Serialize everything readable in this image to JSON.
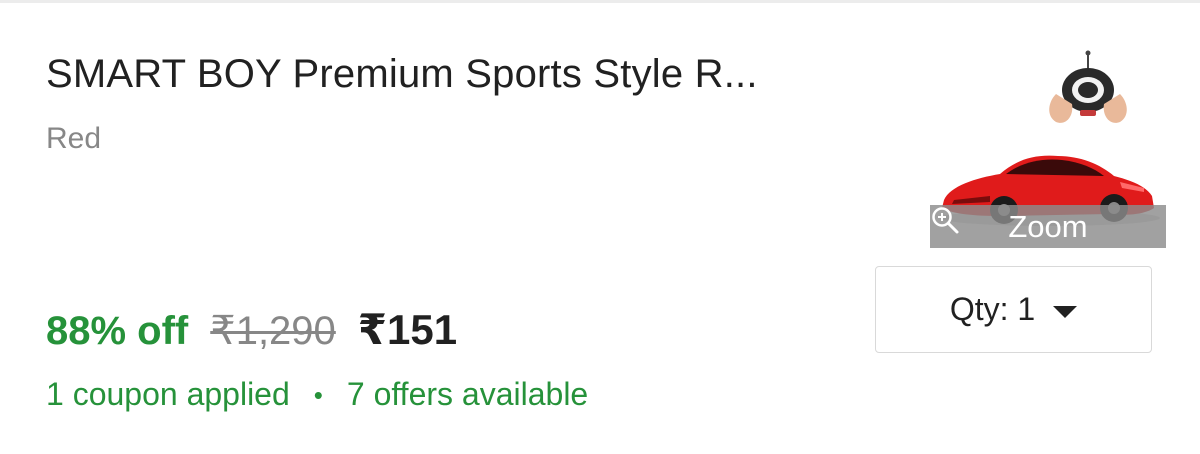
{
  "product": {
    "title": "SMART BOY Premium Sports Style R...",
    "variant": "Red",
    "image": {
      "zoom_label": "Zoom",
      "icon": "zoom-in-icon",
      "car_color": "#e01b1b"
    }
  },
  "quantity": {
    "label": "Qty: 1",
    "icon": "chevron-down-icon"
  },
  "pricing": {
    "discount": "88% off",
    "original_price": "₹1,290",
    "final_price": "₹151",
    "discount_color": "#26923a"
  },
  "offers": {
    "coupon_text": "1 coupon applied",
    "separator": "•",
    "offers_text": "7 offers available",
    "color": "#26923a"
  }
}
